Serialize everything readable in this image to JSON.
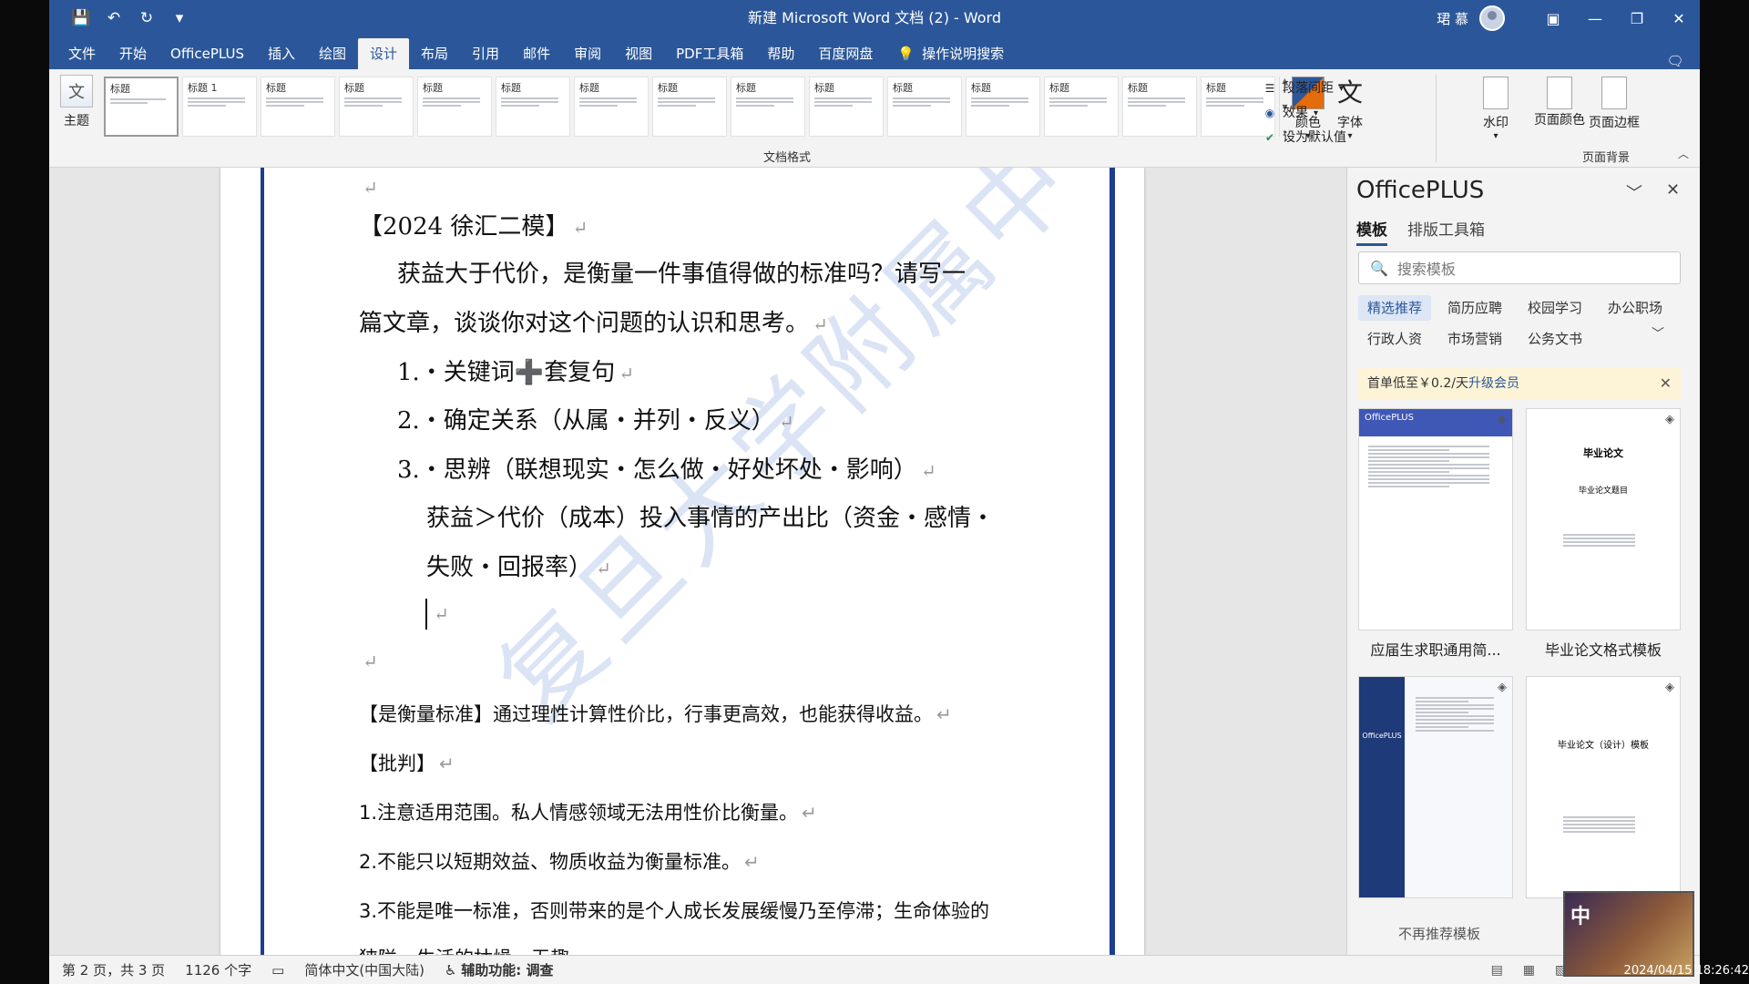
{
  "titlebar": {
    "title": "新建 Microsoft Word 文档 (2) - Word",
    "user": "珺 慕",
    "qat": {
      "save_icon": "save-icon",
      "undo_icon": "undo-icon",
      "redo_icon": "redo-icon",
      "customize_icon": "chevron-down-icon"
    }
  },
  "tabs": [
    "文件",
    "开始",
    "OfficePLUS",
    "插入",
    "绘图",
    "设计",
    "布局",
    "引用",
    "邮件",
    "审阅",
    "视图",
    "PDF工具箱",
    "帮助",
    "百度网盘"
  ],
  "active_tab": "设计",
  "tell_me": "操作说明搜索",
  "ribbon": {
    "theme_label": "主题",
    "theme_icon_text": "文",
    "gallery": [
      {
        "title": "标题"
      },
      {
        "title": "标题 1"
      },
      {
        "title": "标题"
      },
      {
        "title": "标题"
      },
      {
        "title": "标题"
      },
      {
        "title": "标题"
      },
      {
        "title": "标题"
      },
      {
        "title": "标题"
      },
      {
        "title": "标题"
      },
      {
        "title": "标题"
      },
      {
        "title": "标题"
      },
      {
        "title": "标题"
      },
      {
        "title": "标题"
      },
      {
        "title": "标题"
      },
      {
        "title": "标题"
      }
    ],
    "group_label_format": "文档格式",
    "colors_label": "颜色",
    "fonts_label": "字体",
    "fonts_icon_text": "文",
    "paragraph_spacing": "段落间距",
    "effects": "效果",
    "set_default": "设为默认值",
    "watermark_label": "水印",
    "page_color_label": "页面颜色",
    "page_borders_label": "页面边框",
    "group_label_bg": "页面背景"
  },
  "document": {
    "pilcrow": "↵",
    "p_heading": "【2024 徐汇二模】",
    "p_prompt_1": "获益大于代价，是衡量一件事值得做的标准吗？请写一",
    "p_prompt_2": "篇文章，谈谈你对这个问题的认识和思考。",
    "item1_a": "1.‧关键词",
    "item1_plus": "➕",
    "item1_b": "套复句",
    "item2": "2.‧确定关系（从属‧并列‧反义）",
    "item3": "3.‧思辨（联想现实‧怎么做‧好处坏处‧影响）",
    "item3_sub1": "获益＞代价（成本）投入事情的产出比（资金‧感情‧",
    "item3_sub2": "失败‧回报率）",
    "p_standard": "【是衡量标准】通过理性计算性价比，行事更高效，也能获得收益。",
    "p_critique": "【批判】",
    "c1": "1.注意适用范围。私人情感领域无法用性价比衡量。",
    "c2": "2.不能只以短期效益、物质收益为衡量标准。",
    "c3": "3.不能是唯一标准，否则带来的是个人成长发展缓慢乃至停滞；生命体验的",
    "c4": "狭隘，生活的枯燥、无趣",
    "watermark": "复旦大学附属中学"
  },
  "pane": {
    "title": "OfficePLUS",
    "tabs": [
      "模板",
      "排版工具箱"
    ],
    "search_placeholder": "搜索模板",
    "categories": [
      "精选推荐",
      "简历应聘",
      "校园学习",
      "办公职场",
      "行政人资",
      "市场营销",
      "公务文书"
    ],
    "promo_text": "首单低至￥0.2/天",
    "promo_link": "升级会员",
    "templates": [
      {
        "label": "应届生求职通用简...",
        "thumb_text": "OfficePLUS"
      },
      {
        "label": "毕业论文格式模板",
        "thumb_text": "毕业论文",
        "thumb_sub": "毕业论文题目"
      },
      {
        "label": "",
        "thumb_text": "OfficePLUS"
      },
      {
        "label": "",
        "thumb_text": "毕业论文（设计）模板"
      }
    ],
    "no_recommend": "不再推荐模板"
  },
  "overlay": {
    "ime": "中"
  },
  "status": {
    "page": "第 2 页，共 3 页",
    "words": "1126 个字",
    "language": "简体中文(中国大陆)",
    "accessibility": "辅助功能: 调查"
  },
  "datetime": "2024/04/15 18:26:42",
  "colors": {
    "brand": "#2b579a",
    "page_border": "#1d3d8f",
    "plus_icon": "#3f58b5"
  }
}
